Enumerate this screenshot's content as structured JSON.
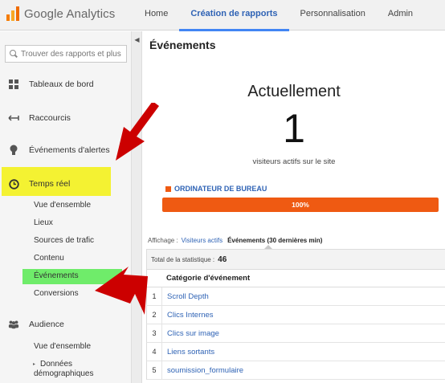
{
  "header": {
    "app_name": "Google Analytics",
    "nav": [
      {
        "label": "Home",
        "active": false
      },
      {
        "label": "Création de rapports",
        "active": true
      },
      {
        "label": "Personnalisation",
        "active": false
      },
      {
        "label": "Admin",
        "active": false
      }
    ],
    "accent_color": "#4285f4"
  },
  "sidebar": {
    "search_placeholder": "Trouver des rapports et plus",
    "items": [
      {
        "label": "Tableaux de bord",
        "icon": "grid-icon"
      },
      {
        "label": "Raccourcis",
        "icon": "shortcut-arrows-icon"
      },
      {
        "label": "Événements d'alertes",
        "icon": "lightbulb-icon"
      },
      {
        "label": "Temps réel",
        "icon": "clock-icon",
        "highlight": "#f4f232"
      },
      {
        "label": "Audience",
        "icon": "people-icon"
      }
    ],
    "realtime_subitems": [
      {
        "label": "Vue d'ensemble"
      },
      {
        "label": "Lieux"
      },
      {
        "label": "Sources de trafic"
      },
      {
        "label": "Contenu"
      },
      {
        "label": "Événements",
        "highlight": "#6fec6a"
      },
      {
        "label": "Conversions"
      }
    ],
    "audience_subitems": [
      {
        "label": "Vue d'ensemble"
      },
      {
        "label_line1": "Données",
        "label_line2": "démographiques",
        "expandable": true
      }
    ]
  },
  "main": {
    "page_title": "Événements",
    "now_title": "Actuellement",
    "active_count": "1",
    "active_caption": "visiteurs actifs sur le site",
    "device_label": "ORDINATEUR DE BUREAU",
    "device_share_percent": 100,
    "device_share_label": "100%",
    "device_color": "#ef5a12",
    "view": {
      "prefix": "Affichage :",
      "link_label": "Visiteurs actifs",
      "current_label": "Événements (30 dernières min)"
    },
    "total": {
      "label": "Total de la statistique :",
      "value": "46"
    },
    "table": {
      "column_header": "Catégorie d'événement",
      "rows": [
        {
          "index": "1",
          "category": "Scroll Depth"
        },
        {
          "index": "2",
          "category": "Clics Internes"
        },
        {
          "index": "3",
          "category": "Clics sur image"
        },
        {
          "index": "4",
          "category": "Liens sortants"
        },
        {
          "index": "5",
          "category": "soumission_formulaire"
        }
      ]
    }
  },
  "annotations": {
    "arrow_color": "#cc0000"
  }
}
